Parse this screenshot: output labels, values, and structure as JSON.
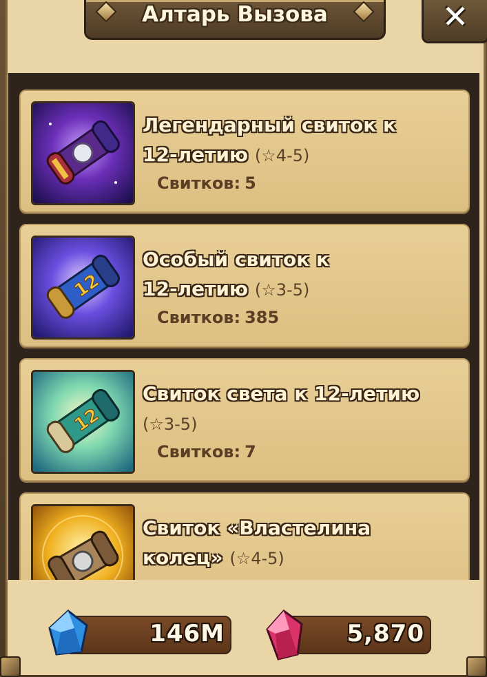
{
  "window": {
    "title": "Алтарь Вызова",
    "close_label": "✕"
  },
  "scrolls": [
    {
      "title_line1": "Легендарный свиток к",
      "title_line2": "12-летию",
      "rating": "(☆4-5)",
      "count_label": "Свитков:",
      "count_value": "5",
      "icon": "legendary-scroll-icon",
      "accent": "#6b2fb8"
    },
    {
      "title_line1": "Особый свиток к",
      "title_line2": "12-летию",
      "rating": "(☆3-5)",
      "count_label": "Свитков:",
      "count_value": "385",
      "icon": "special-scroll-icon",
      "accent": "#3b4fc9"
    },
    {
      "title_line1": "Свиток света к 12-летию",
      "title_line2": "",
      "rating": "(☆3-5)",
      "count_label": "Свитков:",
      "count_value": "7",
      "icon": "light-scroll-icon",
      "accent": "#2fb2a8"
    },
    {
      "title_line1": "Свиток «Властелина",
      "title_line2": "колец»",
      "rating": "(☆4-5)",
      "count_label": "",
      "count_value": "",
      "icon": "lotr-scroll-icon",
      "accent": "#e6a524"
    }
  ],
  "currencies": {
    "crystals": {
      "value": "146M",
      "icon": "blue-crystal-icon",
      "color": "#2f8fe0"
    },
    "gems": {
      "value": "5,870",
      "icon": "red-gem-icon",
      "color": "#d9336a"
    }
  }
}
